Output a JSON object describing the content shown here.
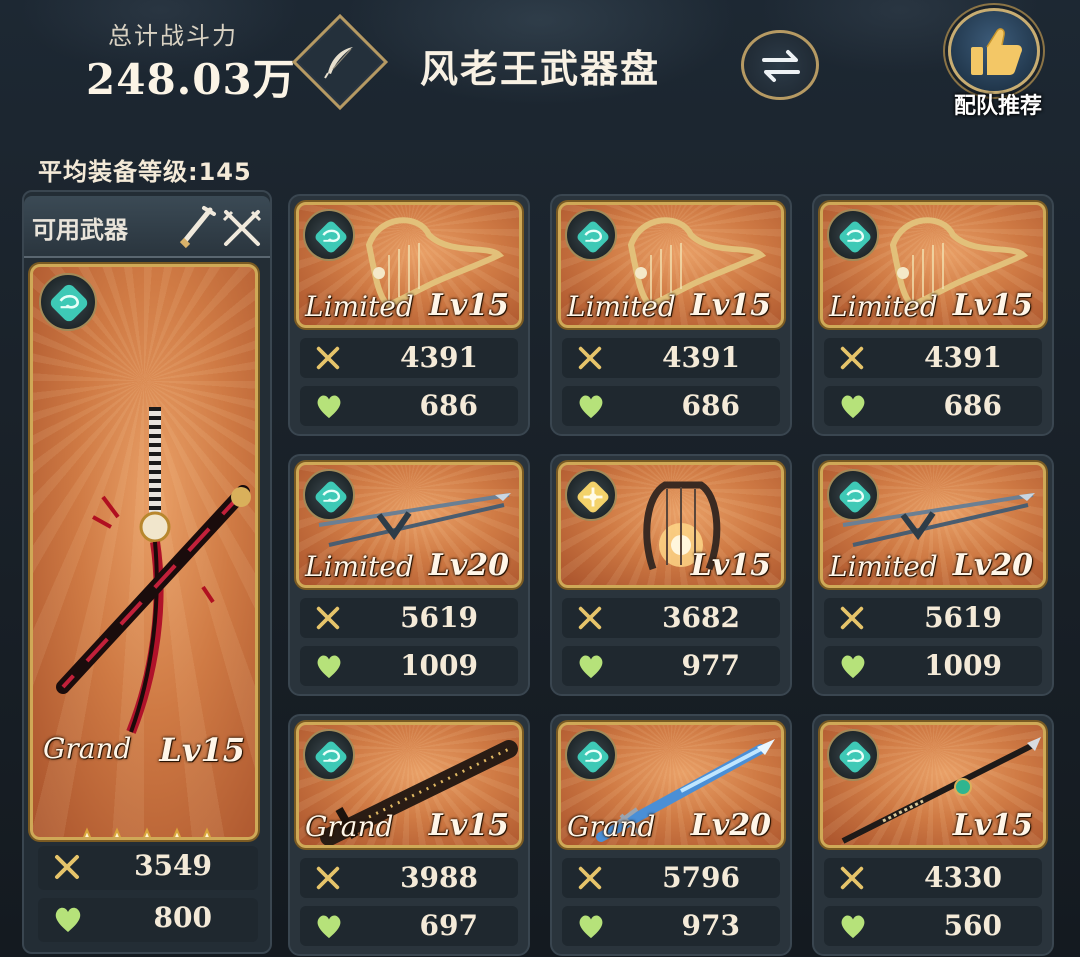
{
  "header": {
    "power_label": "总计战斗力",
    "power_value": "248.03万",
    "title": "风老王武器盘",
    "recommend_label": "配队推荐"
  },
  "avg_level": "平均装备等级:145",
  "available": {
    "label": "可用武器"
  },
  "main_weapon": {
    "element": "wind",
    "tier": "Grand",
    "level": "Lv15",
    "stars": 5,
    "attack": "3549",
    "hp": "800",
    "art": "crossed-katanas"
  },
  "cards": [
    {
      "element": "wind",
      "tier": "Limited",
      "level": "Lv15",
      "attack": "4391",
      "hp": "686",
      "art": "harp"
    },
    {
      "element": "wind",
      "tier": "Limited",
      "level": "Lv15",
      "attack": "4391",
      "hp": "686",
      "art": "harp"
    },
    {
      "element": "wind",
      "tier": "Limited",
      "level": "Lv15",
      "attack": "4391",
      "hp": "686",
      "art": "harp"
    },
    {
      "element": "wind",
      "tier": "Limited",
      "level": "Lv20",
      "attack": "5619",
      "hp": "1009",
      "art": "crossed-spears"
    },
    {
      "element": "light",
      "tier": "",
      "level": "Lv15",
      "attack": "3682",
      "hp": "977",
      "art": "dark-harp"
    },
    {
      "element": "wind",
      "tier": "Limited",
      "level": "Lv20",
      "attack": "5619",
      "hp": "1009",
      "art": "crossed-spears"
    },
    {
      "element": "wind",
      "tier": "Grand",
      "level": "Lv15",
      "attack": "3988",
      "hp": "697",
      "art": "greatsword"
    },
    {
      "element": "wind",
      "tier": "Grand",
      "level": "Lv20",
      "attack": "5796",
      "hp": "973",
      "art": "ice-spear"
    },
    {
      "element": "wind",
      "tier": "",
      "level": "Lv15",
      "attack": "4330",
      "hp": "560",
      "art": "lance"
    }
  ],
  "colors": {
    "wind": "#3ec9b6",
    "light": "#f3d26a",
    "gold_frame": "#cfa957",
    "attack_icon": "#e6c46a",
    "hp_icon": "#b6e27a"
  },
  "icons": {
    "quill": "quill-icon",
    "swap": "swap-arrows-icon",
    "recommend": "thumbs-up-icon",
    "attack": "crossed-swords-icon",
    "hp": "heart-icon"
  }
}
